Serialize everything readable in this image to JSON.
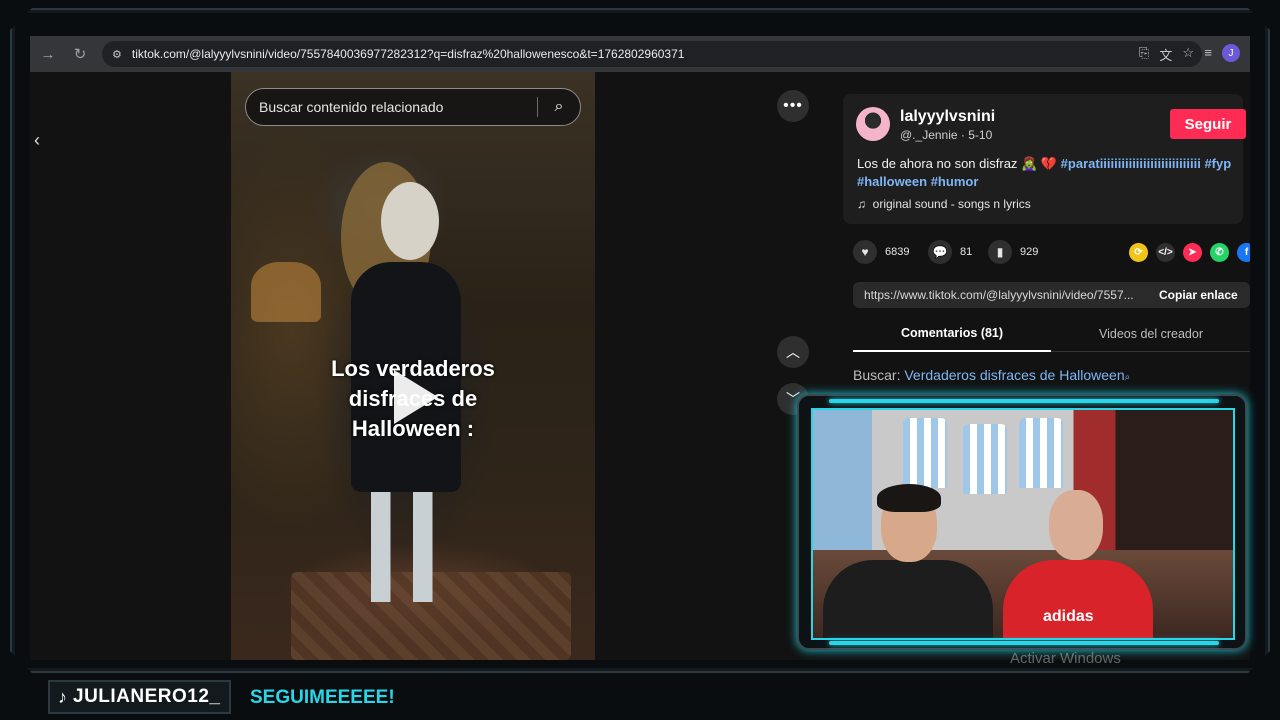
{
  "browser": {
    "url": "tiktok.com/@lalyyylvsnini/video/7557840036977282312?q=disfraz%20hallowenesco&t=1762802960371",
    "profile_initial": "J"
  },
  "video": {
    "search_placeholder": "Buscar contenido relacionado",
    "overlay_line1": "Los verdaderos",
    "overlay_line2": "disfraces de",
    "overlay_line3": "Halloween :",
    "more_label": "•••"
  },
  "post": {
    "username": "lalyyylvsnini",
    "display_name": "@._Jennie",
    "date": "5-10",
    "follow_label": "Seguir",
    "caption_text": "Los de ahora no son disfraz 🧟‍♀️ 💔",
    "hashtags_line1": [
      "#paratiiiiiiiiiiiiiiiiiiiiiiiiiiii",
      "#fyp"
    ],
    "hashtags_line2": [
      "#halloween",
      "#humor"
    ],
    "sound": "original sound - songs n lyrics",
    "likes": "6839",
    "comments": "81",
    "saves": "929",
    "link": "https://www.tiktok.com/@lalyyylvsnini/video/7557...",
    "copy_label": "Copiar enlace"
  },
  "tabs": [
    {
      "label": "Comentarios (81)",
      "active": true
    },
    {
      "label": "Videos del creador",
      "active": false
    }
  ],
  "related_search": {
    "prefix": "Buscar:",
    "query": "Verdaderos disfraces de Halloween"
  },
  "stream": {
    "handle": "JULIANERO12_",
    "cta": "SEGUIMEEEEE!",
    "watermark": "Activar Windows"
  },
  "colors": {
    "accent": "#29d5e6",
    "follow": "#fe2c55",
    "hashtag": "#7fb6f5"
  }
}
